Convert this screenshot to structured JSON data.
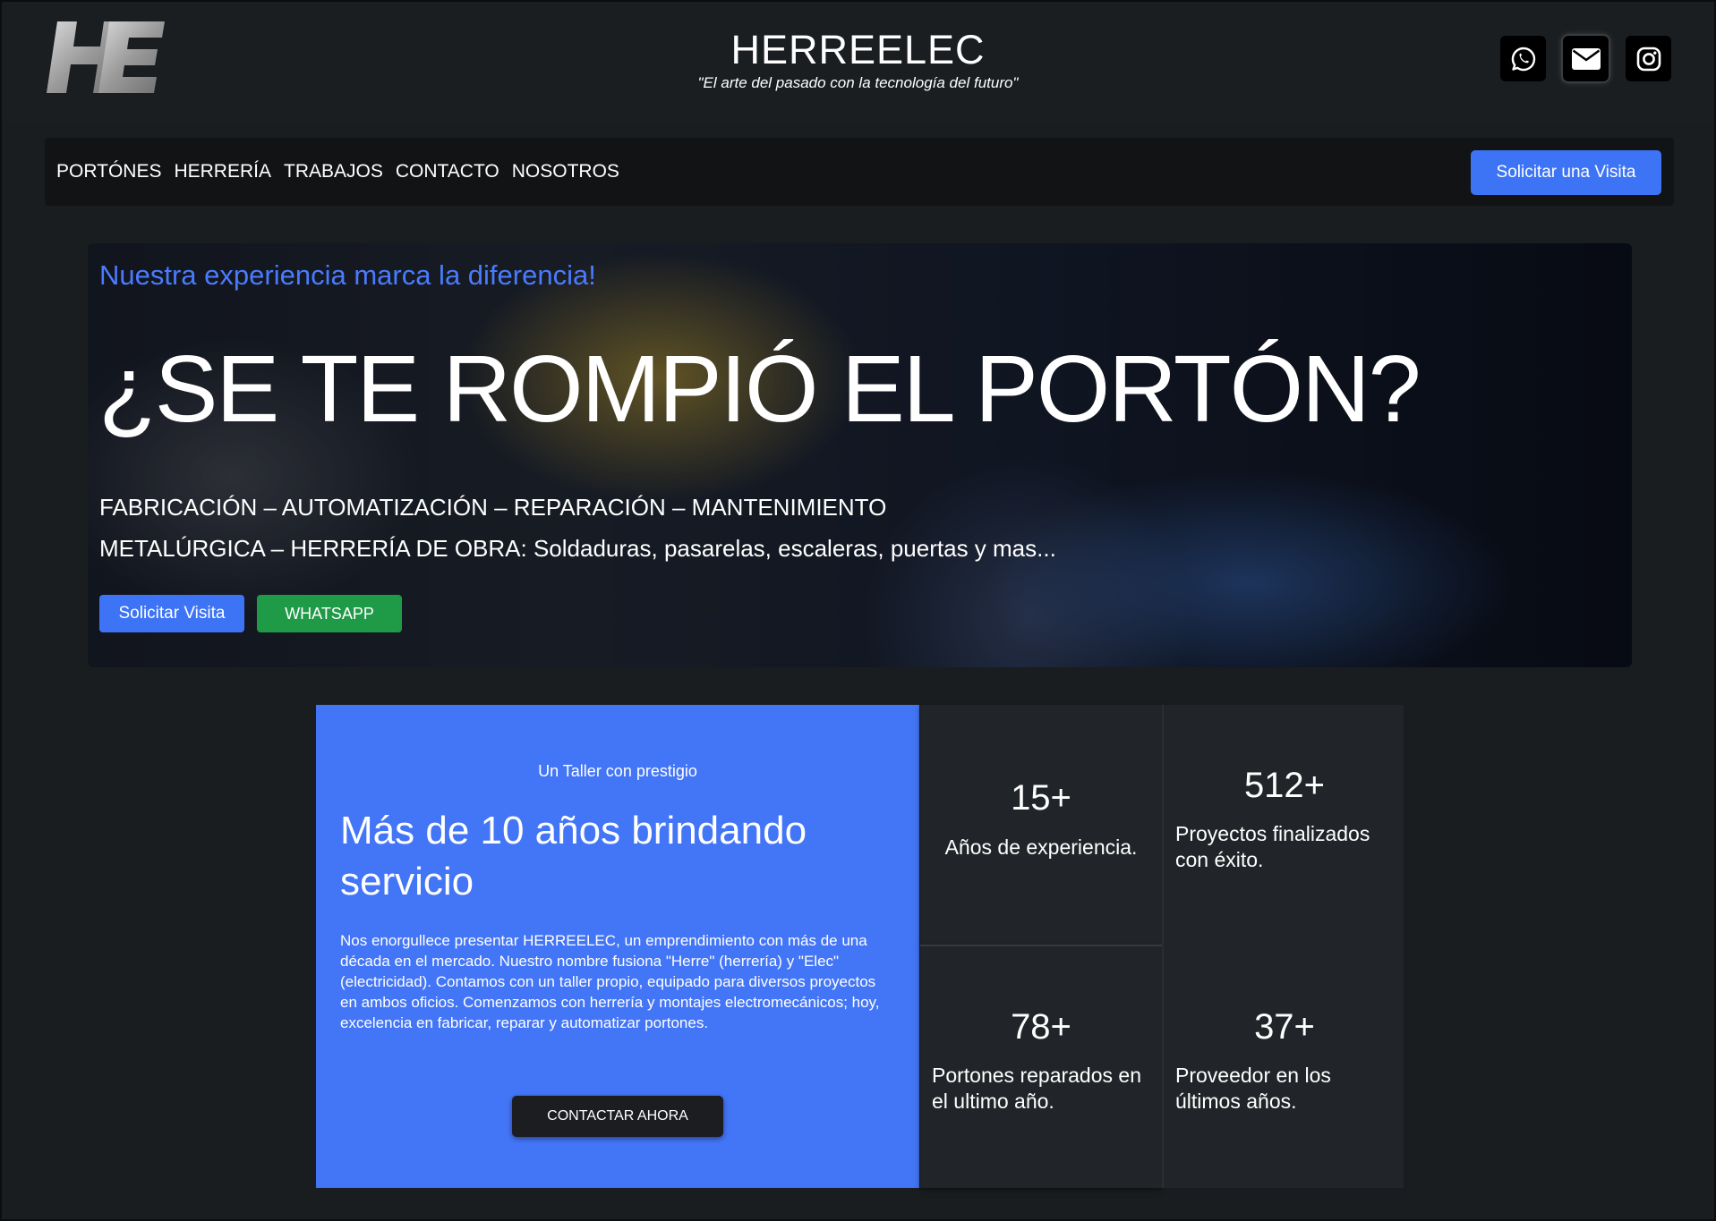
{
  "header": {
    "logo_text": "HE",
    "title": "HERREELEC",
    "tagline": "\"El arte del pasado con la tecnología del futuro\"",
    "social_icons": [
      "whatsapp-icon",
      "mail-icon",
      "instagram-icon"
    ]
  },
  "nav": {
    "items": [
      {
        "label": "PORTÓNES"
      },
      {
        "label": "HERRERÍA"
      },
      {
        "label": "TRABAJOS"
      },
      {
        "label": "CONTACTO"
      },
      {
        "label": "NOSOTROS"
      }
    ],
    "cta": "Solicitar una Visita"
  },
  "hero": {
    "kicker": "Nuestra experiencia marca la diferencia!",
    "title": "¿SE TE ROMPIÓ EL PORTÓN?",
    "line1": "FABRICACIÓN – AUTOMATIZACIÓN – REPARACIÓN – MANTENIMIENTO",
    "line2": "METALÚRGICA – HERRERÍA DE OBRA: Soldaduras, pasarelas, escaleras, puertas y mas...",
    "btn_visit": "Solicitar Visita",
    "btn_whatsapp": "WHATSAPP"
  },
  "about": {
    "kicker": "Un Taller con prestigio",
    "title": "Más de 10 años brindando servicio",
    "text": "Nos enorgullece presentar HERREELEC, un emprendimiento con más de una década en el mercado. Nuestro nombre fusiona \"Herre\" (herrería) y \"Elec\" (electricidad). Contamos con un taller propio, equipado para diversos proyectos en ambos oficios. Comenzamos con herrería y montajes electromecánicos; hoy, excelencia en fabricar, reparar y automatizar portones.",
    "button": "CONTACTAR AHORA"
  },
  "stats": [
    {
      "value": "15+",
      "label": "Años de experiencia."
    },
    {
      "value": "512+",
      "label": "Proyectos finalizados con éxito."
    },
    {
      "value": "78+",
      "label": "Portones reparados en el ultimo año."
    },
    {
      "value": "37+",
      "label": "Proveedor en los últimos años."
    }
  ],
  "colors": {
    "accent": "#3d74f5",
    "whatsapp_green": "#1f9a46",
    "background": "#1a1d20",
    "card": "#212529"
  }
}
